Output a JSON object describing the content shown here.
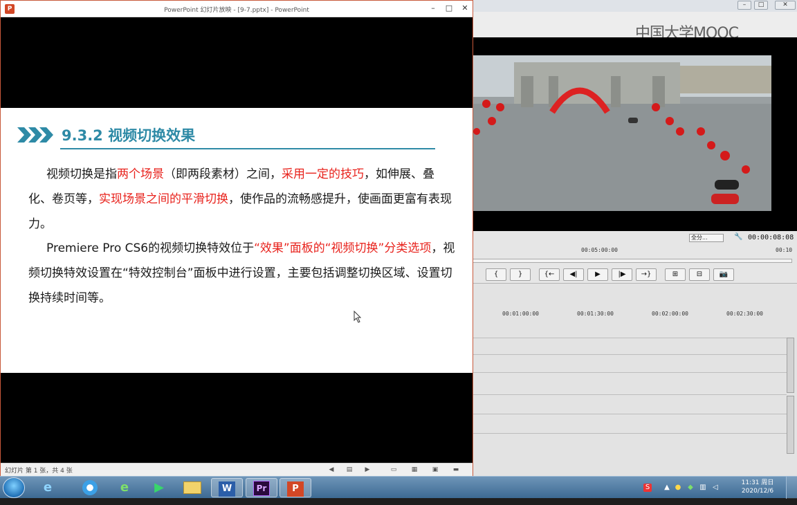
{
  "ppt": {
    "title": "PowerPoint 幻灯片放映 - [9-7.pptx] - PowerPoint",
    "app_icon": "P",
    "minimize": "–",
    "maximize": "□",
    "close": "✕",
    "status_text": "幻灯片 第 1 张，共 4 张"
  },
  "slide": {
    "heading": "9.3.2  视频切换效果",
    "p1": {
      "a": "视频切换是指",
      "b": "两个场景",
      "c": "（即两段素材）之间，",
      "d": "采用一定的技巧",
      "e": "，如伸展、叠化、卷页等，",
      "f": "实现场景之间的平滑切换",
      "g": "，使作品的流畅感提升，使画面更富有表现力。"
    },
    "p2": {
      "a": "Premiere Pro CS6的视频切换特效位于",
      "b": "“效果”面板的“视频切换”分类选项",
      "c": "，视频切换特效设置在“特效控制台”面板中进行设置，主要包括调整切换区域、设置切换持续时间等。"
    }
  },
  "premiere": {
    "watermark": "中国大学MOOC",
    "fit_select": "全分...",
    "timecode": "00:00:08:08",
    "ruler_mark": "00:05:00:00",
    "ruler_mark_end": "00:10",
    "controls": [
      "{",
      "}",
      "{←",
      "◀|",
      "▶",
      "|▶",
      "→}",
      "⊞",
      "⊟",
      "📷"
    ],
    "timeline_marks": [
      "00:01:00:00",
      "00:01:30:00",
      "00:02:00:00",
      "00:02:30:00"
    ]
  },
  "taskbar": {
    "items": [
      "e",
      "e",
      "▶",
      "W",
      "Pr",
      "P"
    ],
    "time": "11:31 周日",
    "date": "2020/12/6"
  },
  "colors": {
    "heading": "#2e8aa6",
    "red_text": "#e8221c",
    "ppt_border": "#c8583a"
  }
}
